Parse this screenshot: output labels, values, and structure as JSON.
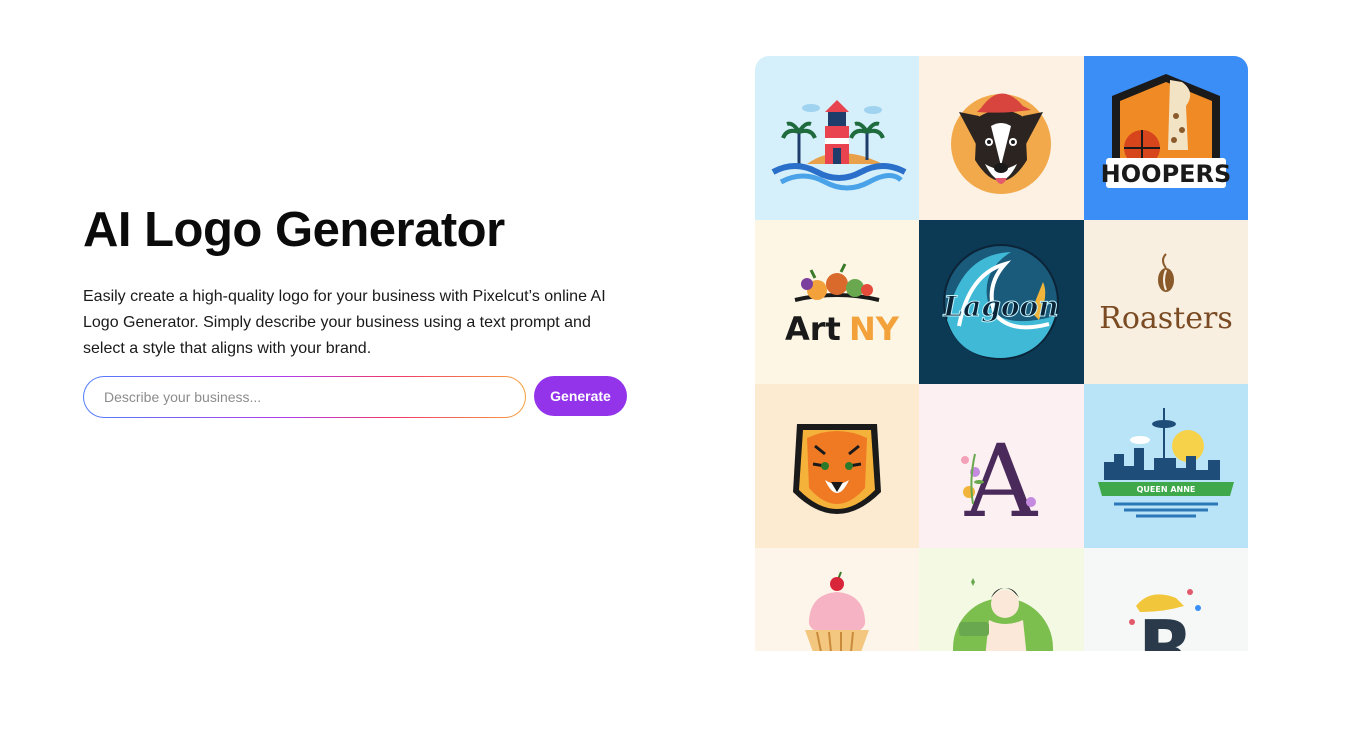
{
  "hero": {
    "title": "AI Logo Generator",
    "description": "Easily create a high-quality logo for your business with Pixelcut’s online AI Logo Generator. Simply describe your business using a text prompt and select a style that aligns with your brand.",
    "input_placeholder": "Describe your business...",
    "input_value": "",
    "generate_label": "Generate"
  },
  "colors": {
    "accent": "#9333ea",
    "input_border_gradient": [
      "#4f7dff",
      "#b03cf0",
      "#f0386a",
      "#f6a03b"
    ]
  },
  "gallery": {
    "tiles": [
      {
        "name": "lighthouse-island",
        "bg": "#d6f0fb"
      },
      {
        "name": "dog-with-cap",
        "bg": "#fdf1e3"
      },
      {
        "name": "giraffe-basketball",
        "bg": "#3a8ef6",
        "text": "HOOPERS"
      },
      {
        "name": "fruit-basket",
        "bg": "#fdf6e4",
        "text_a": "Art",
        "text_b": "NY"
      },
      {
        "name": "wave-surfboard",
        "bg": "#0c3a55",
        "text": "Lagoon"
      },
      {
        "name": "coffee-bean",
        "bg": "#f8efe1",
        "text": "Roasters"
      },
      {
        "name": "tiger-head",
        "bg": "#fdebd1"
      },
      {
        "name": "floral-letter",
        "bg": "#fcf0f2",
        "text": "A"
      },
      {
        "name": "city-skyline",
        "bg": "#b9e4f7",
        "text": "QUEEN ANNE"
      },
      {
        "name": "cupcake",
        "bg": "#fdf5e9"
      },
      {
        "name": "woman-with-soap",
        "bg": "#f3f9e3"
      },
      {
        "name": "letter-r-with-hat",
        "bg": "#f6f8f8",
        "text": "R"
      }
    ]
  }
}
